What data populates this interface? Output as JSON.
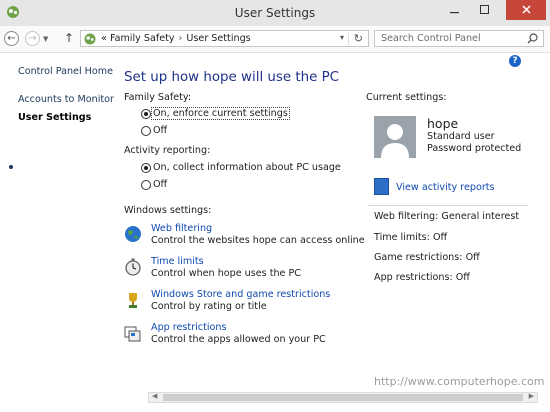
{
  "window": {
    "title": "User Settings"
  },
  "nav": {
    "back_glyph": "←",
    "forward_glyph": "→",
    "up_glyph": "↑",
    "address": {
      "prefix": "«",
      "crumbs": [
        "Family Safety",
        "User Settings"
      ],
      "separator": "›"
    },
    "refresh_glyph": "↻",
    "search_placeholder": "Search Control Panel"
  },
  "sidebar": {
    "items": [
      {
        "label": "Control Panel Home"
      },
      {
        "label": "Accounts to Monitor"
      },
      {
        "label": "User Settings",
        "current": true
      }
    ]
  },
  "main": {
    "heading": "Set up how hope will use the PC",
    "family_safety": {
      "label": "Family Safety:",
      "options": [
        {
          "label": "On, enforce current settings",
          "selected": true
        },
        {
          "label": "Off",
          "selected": false
        }
      ]
    },
    "activity_reporting": {
      "label": "Activity reporting:",
      "options": [
        {
          "label": "On, collect information about PC usage",
          "selected": true
        },
        {
          "label": "Off",
          "selected": false
        }
      ]
    },
    "windows_settings": {
      "label": "Windows settings:",
      "items": [
        {
          "title": "Web filtering",
          "desc": "Control the websites hope can access online",
          "icon": "globe-icon"
        },
        {
          "title": "Time limits",
          "desc": "Control when hope uses the PC",
          "icon": "stopwatch-icon"
        },
        {
          "title": "Windows Store and game restrictions",
          "desc": "Control by rating or title",
          "icon": "trophy-icon"
        },
        {
          "title": "App restrictions",
          "desc": "Control the apps allowed on your PC",
          "icon": "apps-icon"
        }
      ]
    }
  },
  "current": {
    "label": "Current settings:",
    "user_name": "hope",
    "user_type": "Standard user",
    "user_status": "Password protected",
    "reports_link": "View activity reports",
    "summary": [
      {
        "label": "Web filtering:",
        "value": "General interest"
      },
      {
        "label": "Time limits:",
        "value": "Off"
      },
      {
        "label": "Game restrictions:",
        "value": "Off"
      },
      {
        "label": "App restrictions:",
        "value": "Off"
      }
    ]
  },
  "watermark": "http://www.computerhope.com",
  "colors": {
    "heading": "#1e3287",
    "link": "#0f4ab0",
    "close": "#c7463a"
  }
}
